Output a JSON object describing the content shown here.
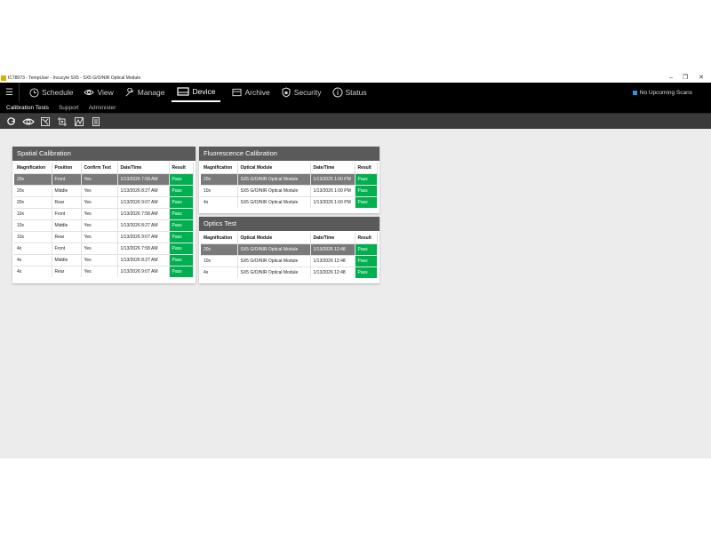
{
  "window": {
    "title": "IC78073 - TempUser - Incucyte SX5 - SX5 G/O/NIR Optical Module",
    "minimize": "–",
    "restore": "❐",
    "close": "✕"
  },
  "nav": {
    "items": [
      {
        "label": "Schedule",
        "icon": "clock-icon"
      },
      {
        "label": "View",
        "icon": "eye-icon"
      },
      {
        "label": "Manage",
        "icon": "wrench-icon"
      },
      {
        "label": "Device",
        "icon": "device-icon"
      },
      {
        "label": "Archive",
        "icon": "archive-icon"
      },
      {
        "label": "Security",
        "icon": "shield-icon"
      },
      {
        "label": "Status",
        "icon": "info-icon"
      }
    ],
    "active": "Device",
    "upcoming": "No Upcoming Scans",
    "accent": "#2196f3"
  },
  "subnav": {
    "items": [
      "Calibration Tests",
      "Support",
      "Administer"
    ],
    "active": "Calibration Tests"
  },
  "toolbar": {
    "icons": [
      "refresh-icon",
      "eye-icon",
      "crop-icon",
      "grid-adjust-icon",
      "chart-icon",
      "document-icon"
    ]
  },
  "spatial": {
    "title": "Spatial Calibration",
    "headers": [
      "Magnification",
      "Position",
      "Confirm Test",
      "Date/Time",
      "Result"
    ],
    "rows": [
      [
        "20x",
        "Front",
        "Yes",
        "1/13/2026 7:58 AM",
        "Pass"
      ],
      [
        "20x",
        "Middle",
        "Yes",
        "1/13/2026 8:27 AM",
        "Pass"
      ],
      [
        "20x",
        "Rear",
        "Yes",
        "1/13/2026 9:07 AM",
        "Pass"
      ],
      [
        "10x",
        "Front",
        "Yes",
        "1/13/2026 7:58 AM",
        "Pass"
      ],
      [
        "10x",
        "Middle",
        "Yes",
        "1/13/2026 8:27 AM",
        "Pass"
      ],
      [
        "10x",
        "Rear",
        "Yes",
        "1/13/2026 9:07 AM",
        "Pass"
      ],
      [
        "4x",
        "Front",
        "Yes",
        "1/13/2026 7:58 AM",
        "Pass"
      ],
      [
        "4x",
        "Middle",
        "Yes",
        "1/13/2026 8:27 AM",
        "Pass"
      ],
      [
        "4x",
        "Rear",
        "Yes",
        "1/13/2026 9:07 AM",
        "Pass"
      ]
    ]
  },
  "fluorescence": {
    "title": "Fluorescence Calibration",
    "headers": [
      "Magnification",
      "Optical Module",
      "Date/Time",
      "Result"
    ],
    "rows": [
      [
        "20x",
        "SX5 G/O/NIR Optical Module",
        "1/13/2026 1:00 PM",
        "Pass"
      ],
      [
        "10x",
        "SX5 G/O/NIR Optical Module",
        "1/13/2026 1:00 PM",
        "Pass"
      ],
      [
        "4x",
        "SX5 G/O/NIR Optical Module",
        "1/13/2026 1:00 PM",
        "Pass"
      ]
    ]
  },
  "optics": {
    "title": "Optics Test",
    "headers": [
      "Magnification",
      "Optical Module",
      "Date/Time",
      "Result"
    ],
    "rows": [
      [
        "20x",
        "SX5 G/O/NIR Optical Module",
        "1/13/2026 12:48",
        "Pass"
      ],
      [
        "10x",
        "SX5 G/O/NIR Optical Module",
        "1/13/2026 12:48",
        "Pass"
      ],
      [
        "4x",
        "SX5 G/O/NIR Optical Module",
        "1/13/2026 12:48",
        "Pass"
      ]
    ]
  },
  "colors": {
    "pass": "#00b050",
    "selected_row": "#7a7a7a"
  }
}
